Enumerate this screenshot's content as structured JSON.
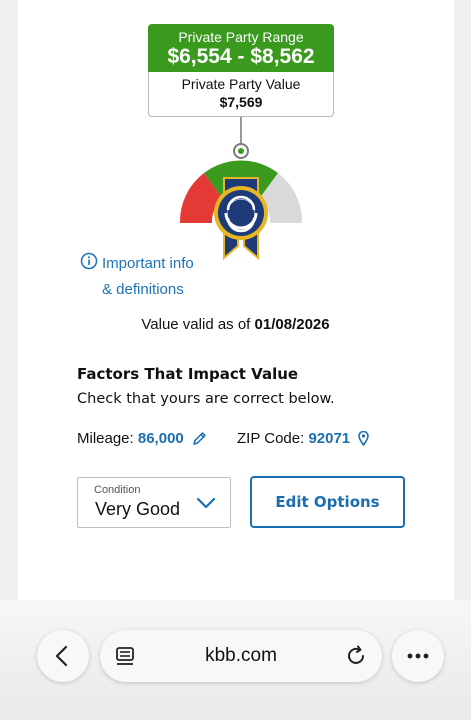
{
  "price_tag": {
    "range_label": "Private Party Range",
    "range_value": "$6,554 - $8,562",
    "value_label": "Private Party Value",
    "value_amount": "$7,569"
  },
  "gauge": {
    "zones": [
      "red",
      "green",
      "gray"
    ],
    "badge": "kbb-ribbon-badge"
  },
  "info": {
    "line1": "Important info",
    "line2": "& definitions"
  },
  "valid": {
    "prefix": "Value valid as of",
    "date": "01/08/2026"
  },
  "factors": {
    "title": "Factors That Impact Value",
    "subtitle": "Check that yours are correct below."
  },
  "mileage": {
    "label": "Mileage:",
    "value": "86,000"
  },
  "zip": {
    "label": "ZIP Code:",
    "value": "92071"
  },
  "condition": {
    "label": "Condition",
    "value": "Very Good"
  },
  "edit_button": "Edit Options",
  "browser": {
    "url": "kbb.com"
  },
  "colors": {
    "range_green": "#3a9a1e",
    "link_blue": "#1b6fb0",
    "gauge_red": "#e53935",
    "gauge_gray": "#d9d9d9",
    "badge_navy": "#1f3a78",
    "badge_gold": "#e6b624"
  }
}
